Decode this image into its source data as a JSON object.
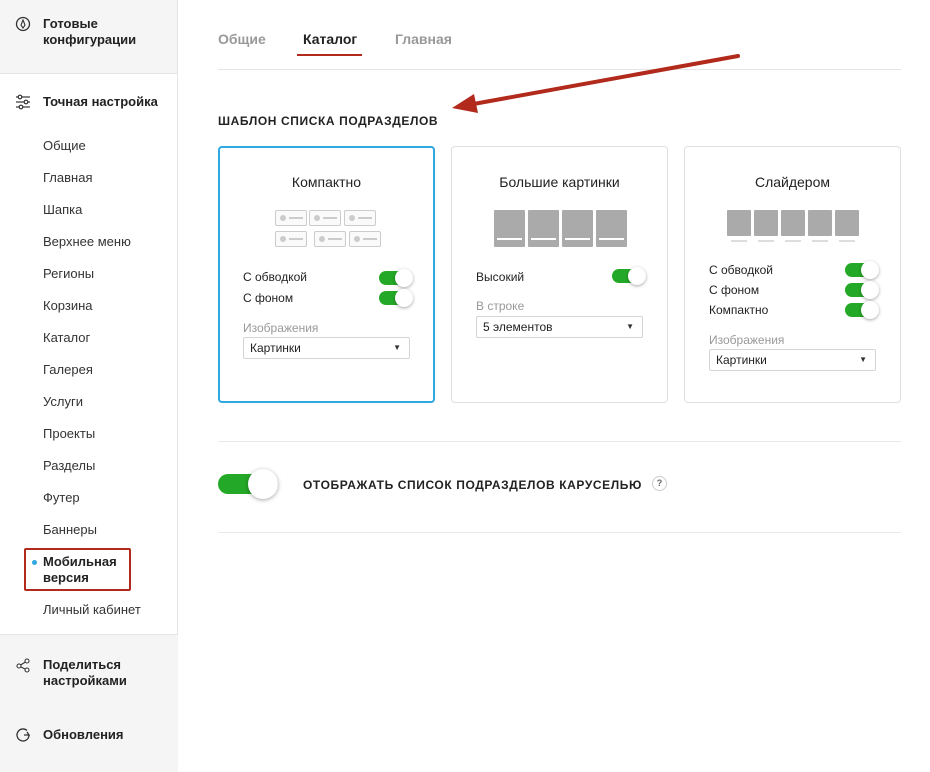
{
  "sidebar": {
    "presets_label": "Готовые конфигурации",
    "fine_tuning_label": "Точная настройка",
    "items": [
      {
        "label": "Общие"
      },
      {
        "label": "Главная"
      },
      {
        "label": "Шапка"
      },
      {
        "label": "Верхнее меню"
      },
      {
        "label": "Регионы"
      },
      {
        "label": "Корзина"
      },
      {
        "label": "Каталог"
      },
      {
        "label": "Галерея"
      },
      {
        "label": "Услуги"
      },
      {
        "label": "Проекты"
      },
      {
        "label": "Разделы"
      },
      {
        "label": "Футер"
      },
      {
        "label": "Баннеры"
      },
      {
        "label": "Мобильная версия",
        "active": true
      },
      {
        "label": "Личный кабинет"
      }
    ],
    "share_label": "Поделиться настройками",
    "updates_label": "Обновления"
  },
  "tabs": [
    {
      "label": "Общие",
      "active": false
    },
    {
      "label": "Каталог",
      "active": true
    },
    {
      "label": "Главная",
      "active": false
    }
  ],
  "section": {
    "title": "ШАБЛОН СПИСКА ПОДРАЗДЕЛОВ"
  },
  "cards": {
    "compact": {
      "title": "Компактно",
      "selected": true,
      "opt_border": "С обводкой",
      "opt_bg": "С фоном",
      "images_label": "Изображения",
      "images_value": "Картинки"
    },
    "big": {
      "title": "Большие картинки",
      "opt_tall": "Высокий",
      "per_row_label": "В строке",
      "per_row_value": "5 элементов"
    },
    "slider": {
      "title": "Слайдером",
      "opt_border": "С обводкой",
      "opt_bg": "С фоном",
      "opt_compact": "Компактно",
      "images_label": "Изображения",
      "images_value": "Картинки"
    }
  },
  "carousel": {
    "label": "ОТОБРАЖАТЬ СПИСОК ПОДРАЗДЕЛОВ КАРУСЕЛЬЮ",
    "enabled": true,
    "help": "?"
  },
  "colors": {
    "accent_blue": "#2fa8e0",
    "toggle_on": "#24a827",
    "highlight_red": "#b22a1c"
  },
  "icons": {
    "presets": "compass-icon",
    "fine_tuning": "sliders-icon",
    "share": "share-icon",
    "updates": "refresh-icon",
    "select_arrow": "caret-down-icon"
  }
}
